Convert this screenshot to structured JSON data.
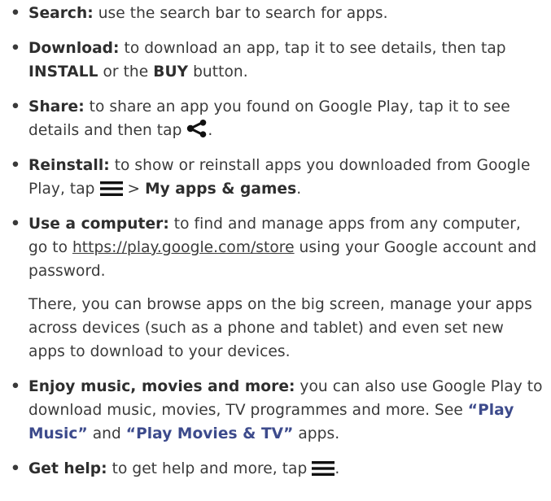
{
  "tips": [
    {
      "term": "Search:",
      "text": " use the search bar to search for apps."
    },
    {
      "term": "Download:",
      "text_before": " to download an app, tap it to see details, then tap ",
      "kw1": "INSTALL",
      "text_mid": " or the ",
      "kw2": "BUY",
      "text_after": " button."
    },
    {
      "term": "Share:",
      "text": " to share an app you found on Google Play, tap it to see details and then tap ",
      "icon": "share-icon",
      "end": "."
    },
    {
      "term": "Reinstall:",
      "text": " to show or reinstall apps you downloaded from Google Play, tap ",
      "icon": "menu-icon",
      "sep": " > ",
      "kw": "My apps & games",
      "end": "."
    },
    {
      "term": "Use a computer:",
      "text_before": " to find and manage apps from any computer, go to ",
      "url": "https://play.google.com/store",
      "text_after": " using your Google account and password."
    },
    {
      "paragraph": "There, you can browse apps on the big screen, manage your apps across devices (such as a phone and tablet) and even set new apps to download to your devices."
    },
    {
      "term": "Enjoy music, movies and more:",
      "text_before": " you can also use Google Play to download music, movies, TV programmes and more. See ",
      "ref1": "“Play Music”",
      "text_mid": " and ",
      "ref2": "“Play Movies & TV”",
      "text_after": " apps."
    },
    {
      "term": "Get help:",
      "text": " to get help and more, tap ",
      "icon": "menu-icon",
      "end": "."
    }
  ],
  "colors": {
    "text": "#3a3a3a",
    "link": "#3d4b8c"
  }
}
